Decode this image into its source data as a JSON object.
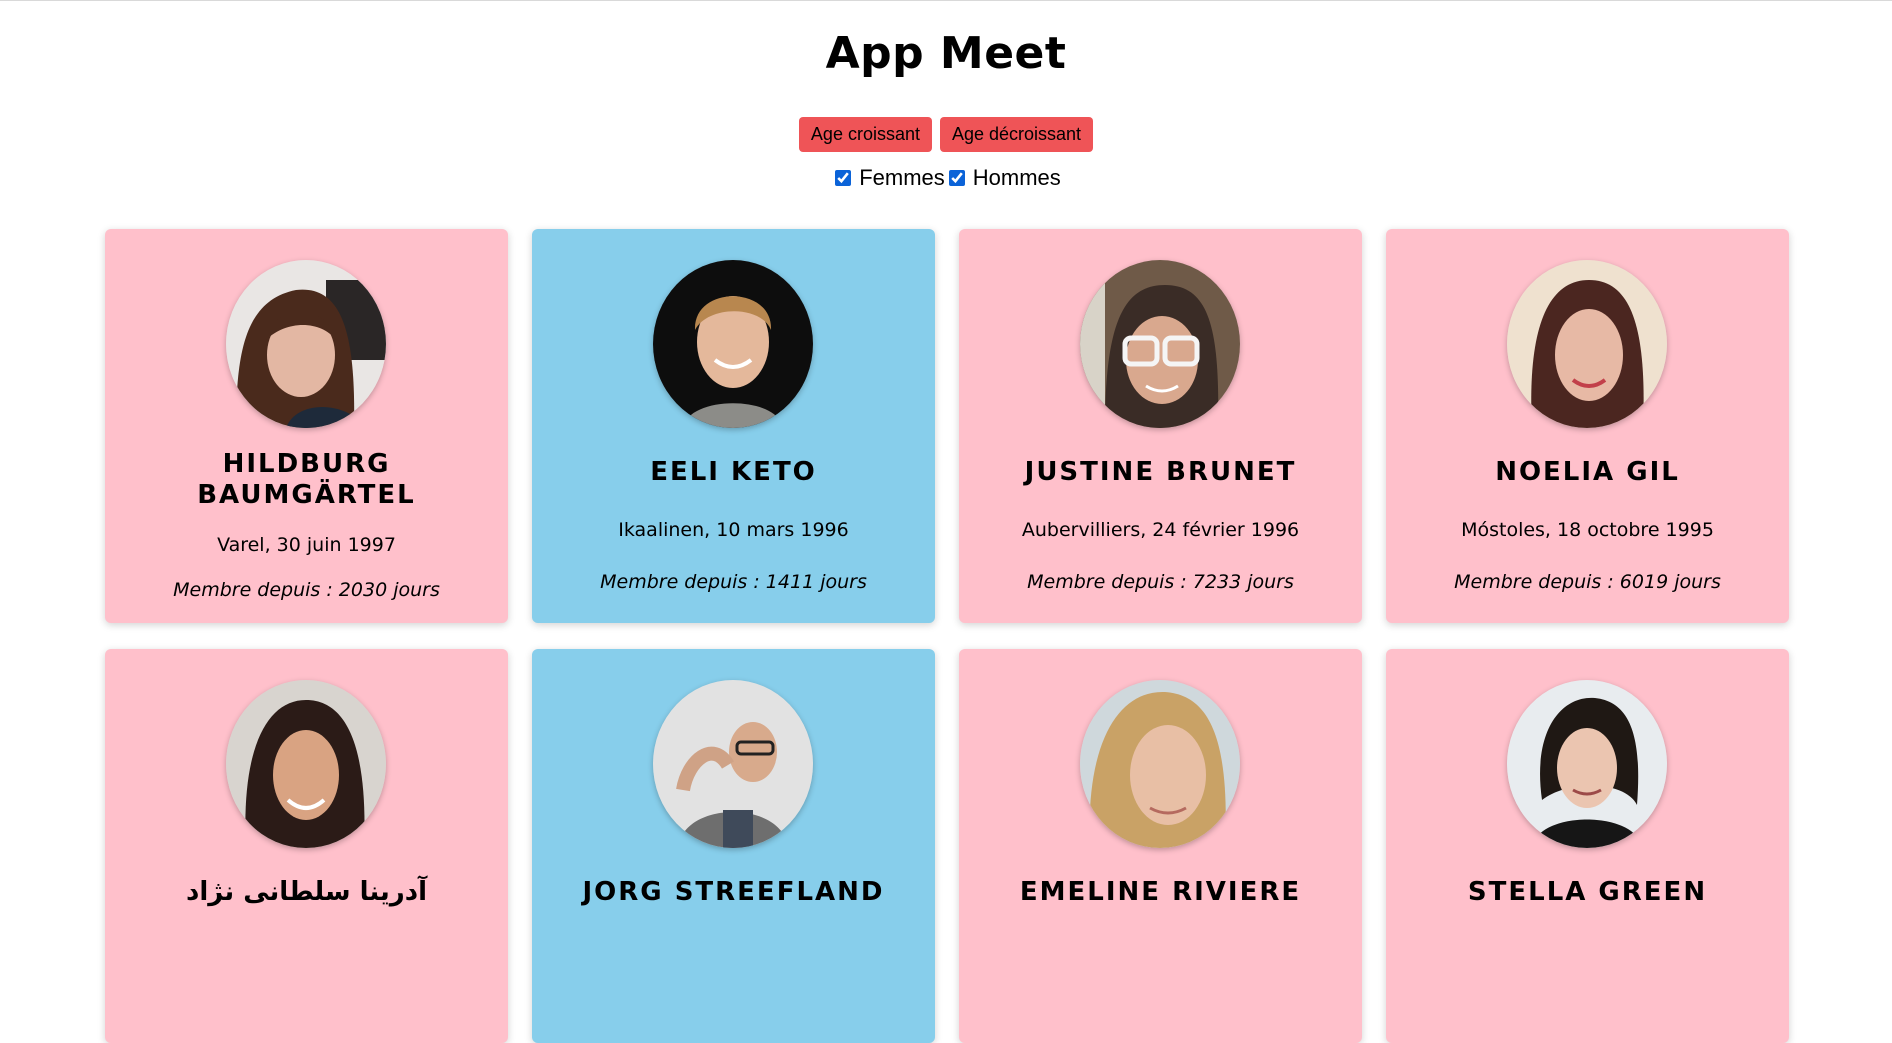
{
  "app": {
    "title": "App Meet"
  },
  "sort": {
    "asc_label": "Age croissant",
    "desc_label": "Age décroissant"
  },
  "filters": {
    "women_label": "Femmes",
    "women_checked": true,
    "men_label": "Hommes",
    "men_checked": true
  },
  "colors": {
    "female_card": "#ffc0cb",
    "male_card": "#87ceeb",
    "button": "#ef5457"
  },
  "cards": [
    {
      "name": "HILDBURG BAUMGÄRTEL",
      "place": "Varel, 30 juin 1997",
      "member": "Membre depuis : 2030 jours",
      "gender": "female"
    },
    {
      "name": "EELI KETO",
      "place": "Ikaalinen, 10 mars 1996",
      "member": "Membre depuis : 1411 jours",
      "gender": "male"
    },
    {
      "name": "JUSTINE BRUNET",
      "place": "Aubervilliers, 24 février 1996",
      "member": "Membre depuis : 7233 jours",
      "gender": "female"
    },
    {
      "name": "NOELIA GIL",
      "place": "Móstoles, 18 octobre 1995",
      "member": "Membre depuis : 6019 jours",
      "gender": "female"
    },
    {
      "name": "آدرینا سلطانی نژاد",
      "place": "",
      "member": "",
      "gender": "female"
    },
    {
      "name": "JORG STREEFLAND",
      "place": "",
      "member": "",
      "gender": "male"
    },
    {
      "name": "EMELINE RIVIERE",
      "place": "",
      "member": "",
      "gender": "female"
    },
    {
      "name": "STELLA GREEN",
      "place": "",
      "member": "",
      "gender": "female"
    }
  ]
}
